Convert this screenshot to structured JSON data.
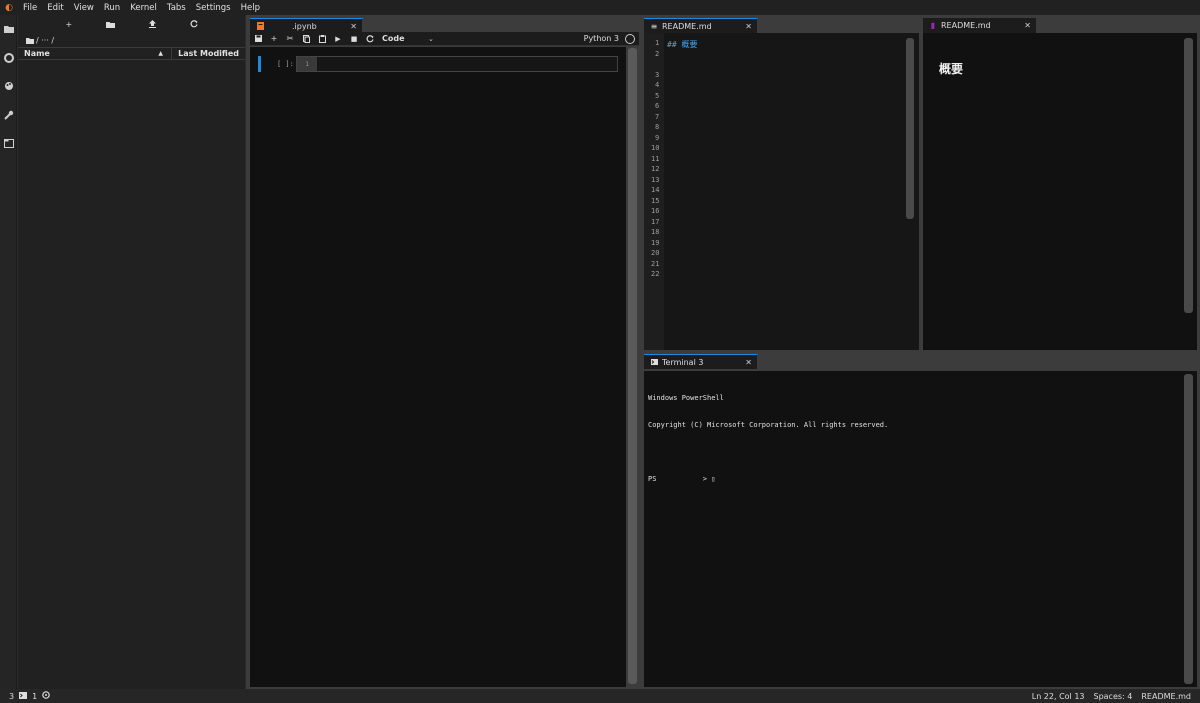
{
  "menu": [
    "File",
    "Edit",
    "View",
    "Run",
    "Kernel",
    "Tabs",
    "Settings",
    "Help"
  ],
  "filebrowser": {
    "toolbar": [
      "+",
      "new-folder",
      "upload",
      "refresh"
    ],
    "breadcrumb": "/ ··· /",
    "col_name": "Name",
    "col_modified": "Last Modified",
    "sort_indicator": "▲"
  },
  "notebook": {
    "tab_label": ".ipynb",
    "cell_type": "Code",
    "kernel": "Python 3",
    "prompt": "[ ]:",
    "line_number": "1"
  },
  "editor": {
    "tab_label": "README.md",
    "first_line": "## 概要",
    "line_numbers": [
      "1",
      "2",
      "",
      "3",
      "4",
      "5",
      "6",
      "7",
      "8",
      "9",
      "10",
      "11",
      "12",
      "13",
      "14",
      "15",
      "16",
      "17",
      "18",
      "19",
      "20",
      "21",
      "22"
    ]
  },
  "preview": {
    "tab_label": "README.md",
    "heading": "概要"
  },
  "terminal": {
    "tab_label": "Terminal 3",
    "line1": "Windows PowerShell",
    "line2": "Copyright (C) Microsoft Corporation. All rights reserved.",
    "prompt": "PS           > ▯"
  },
  "statusbar": {
    "terminals": "3",
    "kernels": "1",
    "position": "Ln 22, Col 13",
    "spaces": "Spaces: 4",
    "file": "README.md"
  },
  "colors": {
    "accent": "#1e88e5",
    "jupyter_orange": "#f37726",
    "markdown_purple": "#9c27b0"
  }
}
